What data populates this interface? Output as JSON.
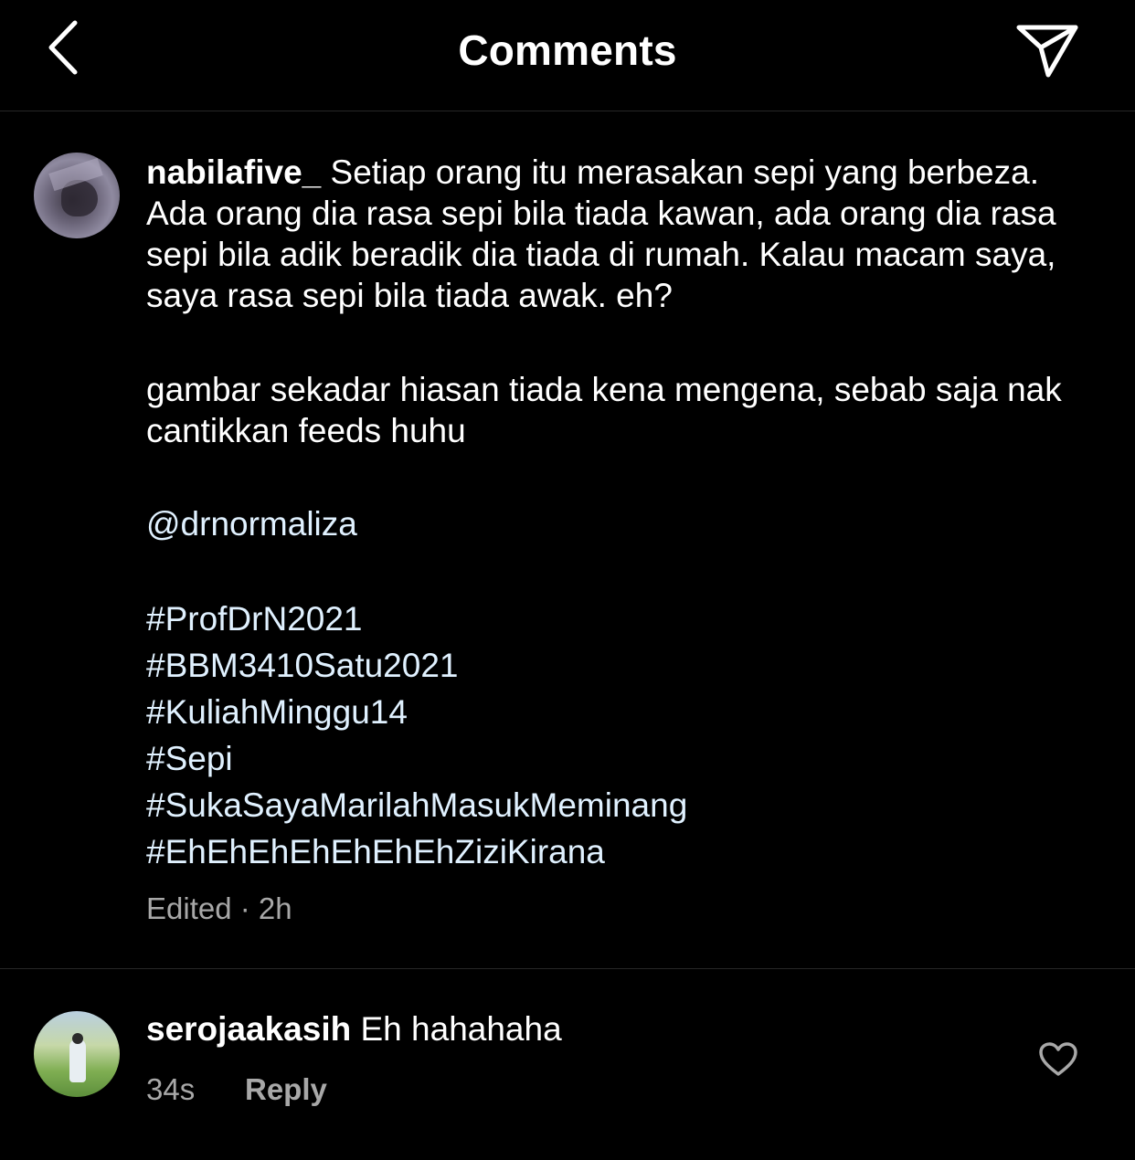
{
  "header": {
    "title": "Comments",
    "back_icon": "chevron-left-icon",
    "share_icon": "paper-plane-icon"
  },
  "caption": {
    "username": "nabilafive_",
    "text": " Setiap orang itu merasakan sepi yang berbeza. Ada orang dia rasa sepi bila tiada kawan, ada orang dia rasa sepi bila adik beradik dia tiada di rumah. Kalau macam saya, saya rasa sepi bila tiada awak. eh?",
    "paragraph2": "gambar sekadar hiasan tiada kena mengena, sebab saja nak cantikkan feeds huhu",
    "mention": "@drnormaliza",
    "hashtags": [
      "#ProfDrN2021",
      "#BBM3410Satu2021",
      "#KuliahMinggu14",
      "#Sepi",
      "#SukaSayaMarilahMasukMeminang",
      "#EhEhEhEhEhEhEhZiziKirana"
    ],
    "meta": "Edited · 2h"
  },
  "comments": [
    {
      "username": "serojaakasih",
      "text": " Eh hahahaha",
      "time": "34s",
      "reply_label": "Reply",
      "like_icon": "heart-outline-icon"
    }
  ],
  "colors": {
    "background": "#000000",
    "text": "#ffffff",
    "secondary_text": "#a8a8a8",
    "link_text": "#e0f1ff",
    "divider": "#262626"
  }
}
